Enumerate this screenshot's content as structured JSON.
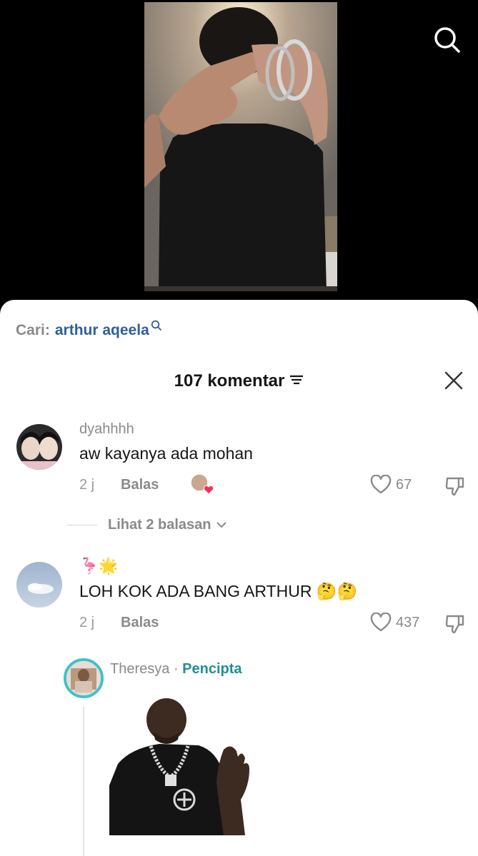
{
  "search": {
    "prefix": "Cari:",
    "keyword": "arthur aqeela"
  },
  "header": {
    "comment_count_label": "107 komentar"
  },
  "comments": [
    {
      "username": "dyahhhh",
      "text": "aw kayanya ada mohan",
      "time": "2 j",
      "reply_label": "Balas",
      "likes": "67",
      "view_replies": "Lihat 2 balasan"
    },
    {
      "username": "🦩🌟",
      "text": "LOH KOK ADA BANG ARTHUR 🤔🤔",
      "time": "2 j",
      "reply_label": "Balas",
      "likes": "437"
    }
  ],
  "reply": {
    "username": "Theresya",
    "separator": "·",
    "badge": "Pencipta"
  },
  "colors": {
    "link_blue": "#2f5f9a",
    "creator_teal": "#1f8f95",
    "heart_red": "#fe2c55"
  }
}
